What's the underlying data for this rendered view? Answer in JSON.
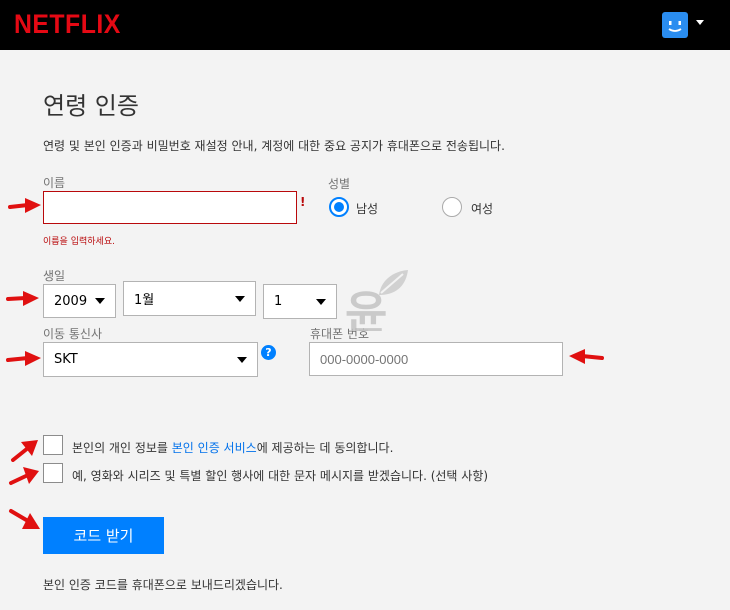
{
  "header": {
    "logo_text": "NETFLIX",
    "profile_icon": "smiley-avatar-icon",
    "profile_caret_icon": "caret-down-icon"
  },
  "page": {
    "title": "연령 인증",
    "description": "연령 및 본인 인증과 비밀번호 재설정 안내, 계정에 대한 중요 공지가 휴대폰으로 전송됩니다."
  },
  "name_field": {
    "label": "이름",
    "value": "",
    "error_mark": "!",
    "error_text": "이름을 입력하세요."
  },
  "gender": {
    "label": "성별",
    "options": [
      "남성",
      "여성"
    ],
    "selected": "남성"
  },
  "birth": {
    "label": "생일",
    "year": "2009",
    "month": "1월",
    "day": "1"
  },
  "carrier": {
    "label": "이동 통신사",
    "value": "SKT",
    "help_text": "?"
  },
  "phone": {
    "label": "휴대폰 번호",
    "placeholder": "000-0000-0000"
  },
  "consents": [
    {
      "before": "본인의 개인 정보를 ",
      "link": "본인 인증 서비스",
      "after": "에 제공하는 데 동의합니다.",
      "checked": false
    },
    {
      "text": "예, 영화와 시리즈 및 특별 할인 행사에 대한 문자 메시지를 받겠습니다. (선택 사항)",
      "checked": false
    }
  ],
  "submit": {
    "label": "코드 받기"
  },
  "footer_note": "본인 인증 코드를 휴대폰으로 보내드리겠습니다.",
  "watermark": {
    "text": "윤",
    "icon": "leaf-icon"
  },
  "colors": {
    "brand_red": "#e50914",
    "accent_blue": "#0080ff",
    "error_red": "#b9090b",
    "arrow_red": "#e01010",
    "link_blue": "#0071eb"
  }
}
